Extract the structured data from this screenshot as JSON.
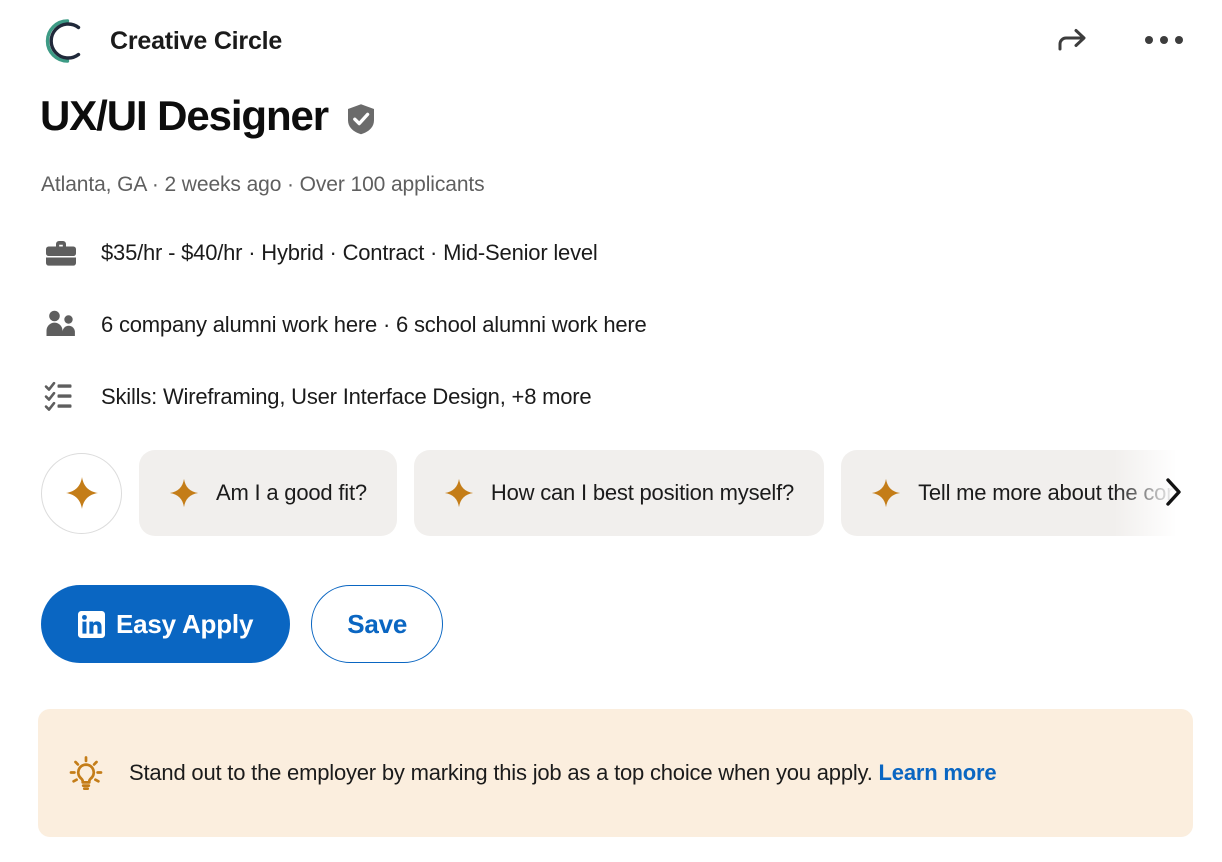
{
  "header": {
    "company_name": "Creative Circle",
    "logo_colors": {
      "outer_arc": "#3d9b85",
      "inner_arc": "#20293a"
    },
    "share_icon": "share-arrow-icon",
    "more_icon": "more-options-icon"
  },
  "job": {
    "title": "UX/UI Designer",
    "verified_icon": "verified-shield-icon",
    "meta": "Atlanta, GA · 2 weeks ago · Over 100 applicants",
    "details": [
      {
        "icon": "briefcase-icon",
        "text": "$35/hr - $40/hr · Hybrid · Contract · Mid-Senior level"
      },
      {
        "icon": "people-icon",
        "text": "6 company alumni work here · 6 school alumni work here"
      },
      {
        "icon": "checklist-icon",
        "text": "Skills: Wireframing, User Interface Design, +8 more"
      }
    ]
  },
  "ai_chips": {
    "sparkle_icon": "sparkle-icon",
    "accent_color": "#c47d18",
    "chip_bg": "#f1efed",
    "items": [
      {
        "label": "Am I a good fit?"
      },
      {
        "label": "How can I best position myself?"
      },
      {
        "label": "Tell me more about the company"
      }
    ],
    "next_icon": "chevron-right-icon"
  },
  "actions": {
    "apply_label": "Easy Apply",
    "apply_icon": "linkedin-logo-icon",
    "save_label": "Save",
    "primary_color": "#0a66c2"
  },
  "banner": {
    "icon": "lightbulb-icon",
    "text_before": "Stand out to the employer by marking this job as a top choice when you apply. ",
    "link_label": "Learn more",
    "bg_color": "#fbeede"
  }
}
